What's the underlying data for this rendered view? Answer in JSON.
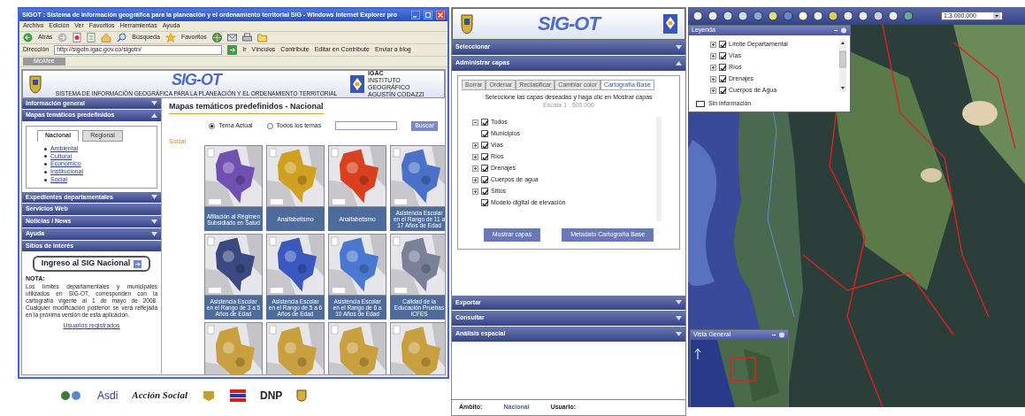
{
  "browser": {
    "title": "SIGOT : Sistema de información geográfica para la planeación y el ordenamiento territorial SIG - Windows Internet Explorer pro",
    "menu": [
      "Archivo",
      "Edición",
      "Ver",
      "Favoritos",
      "Herramientas",
      "Ayuda"
    ],
    "toolbar": [
      "Atrás",
      "Búsqueda",
      "Favoritos"
    ],
    "address_label": "Dirección",
    "address": "http://sigotn.igac.gov.co/sigotn/",
    "go": "Ir",
    "links_label": "Vínculos",
    "extras": [
      "Contribute",
      "Editar en Contribute",
      "Enviar a blog"
    ],
    "tab": "McAfee"
  },
  "site": {
    "logo": "SIG-OT",
    "subtitle": "SISTEMA DE INFORMACIÓN GEOGRÁFICA PARA LA PLANEACIÓN Y EL ORDENAMIENTO TERRITORIAL",
    "org": "IGAC",
    "org_sub": "INSTITUTO GEOGRÁFICO AGUSTÍN CODAZZI",
    "sidebar": [
      {
        "label": "Información general",
        "expanded": false,
        "arrow": true
      },
      {
        "label": "Mapas temáticos predefinidos",
        "expanded": true,
        "arrow": true,
        "tabs": [
          {
            "label": "Nacional",
            "selected": true
          },
          {
            "label": "Regional",
            "selected": false
          }
        ],
        "links": [
          "Ambiental",
          "Cultural",
          "Económico",
          "Institucional",
          "Social"
        ]
      },
      {
        "label": "Expedientes departamentales",
        "expanded": false,
        "arrow": true
      },
      {
        "label": "Servicios Web",
        "expanded": false,
        "arrow": false
      },
      {
        "label": "Noticias / News",
        "expanded": false,
        "arrow": true
      },
      {
        "label": "Ayuda",
        "expanded": false,
        "arrow": true
      },
      {
        "label": "Sitios de interés",
        "expanded": false,
        "arrow": false
      }
    ],
    "login_button": "Ingreso al SIG Nacional",
    "note_title": "NOTA:",
    "note": "Los límites departamentales y municipales utilizados en SIG-OT, corresponden con la cartografía vigente al 1 de mayo de 2008. Cualquier modificación posterior se verá reflejada en la próxima versión de esta aplicación.",
    "registered_link": "Usuarios registrados",
    "main_title": "Mapas temáticos predefinidos - Nacional",
    "radios": [
      {
        "label": "Tema Actual",
        "selected": true
      },
      {
        "label": "Todos los temas",
        "selected": false
      }
    ],
    "search_button": "Buscar",
    "theme": "Social",
    "maps": [
      {
        "caption": "Afiliación al Régimen Subsidiado en Salud",
        "color": "#7050b0"
      },
      {
        "caption": "Analfabetismo",
        "color": "#d0a020"
      },
      {
        "caption": "Analfabetismo",
        "color": "#d84020"
      },
      {
        "caption": "Asistencia Escolar en el Rango de 11 a 17 Años de Edad",
        "color": "#4a70c8"
      },
      {
        "caption": "Asistencia Escolar en el Rango de 3 a 5 Años de Edad",
        "color": "#3a4a80"
      },
      {
        "caption": "Asistencia Escolar en el Rango de 5 a 6 Años de Edad",
        "color": "#3a58c0"
      },
      {
        "caption": "Asistencia Escolar en el Rango de 6 a 10 Años de Edad",
        "color": "#4a78d0"
      },
      {
        "caption": "Calidad de la Educación Pruebas ICFES",
        "color": "#7a8098"
      }
    ],
    "partners": [
      "Asdi",
      "Acción Social",
      "DNP"
    ]
  },
  "layers": {
    "logo": "SIG-OT",
    "sections_top": [
      {
        "label": "Seleccionar",
        "expanded": false
      },
      {
        "label": "Administrar capas",
        "expanded": true
      }
    ],
    "tabs": [
      {
        "label": "Borrar",
        "selected": false
      },
      {
        "label": "Ordenar",
        "selected": false
      },
      {
        "label": "Reclasificar",
        "selected": false
      },
      {
        "label": "Cambiar color",
        "selected": false
      },
      {
        "label": "Cartografía Base",
        "selected": true
      }
    ],
    "instruction": "Seleccione las capas deseadas y haga clic en Mostrar capas",
    "scale": "Escala 1 : 500.000",
    "tree": [
      {
        "label": "Todos",
        "checked": true,
        "children": [
          {
            "label": "Municipios",
            "checked": true,
            "expandable": false
          },
          {
            "label": "Vías",
            "checked": true,
            "expandable": true
          },
          {
            "label": "Ríos",
            "checked": true,
            "expandable": true
          },
          {
            "label": "Drenajes",
            "checked": true,
            "expandable": true
          },
          {
            "label": "Cuerpos de agua",
            "checked": true,
            "expandable": true
          },
          {
            "label": "Sitios",
            "checked": true,
            "expandable": true
          },
          {
            "label": "Modelo digital de elevación",
            "checked": true,
            "expandable": false
          }
        ]
      }
    ],
    "buttons": [
      "Mostrar capas",
      "Metadato Cartografía Base"
    ],
    "sections_bottom": [
      {
        "label": "Exportar",
        "expanded": false
      },
      {
        "label": "Consultar",
        "expanded": false
      },
      {
        "label": "Análisis espacial",
        "expanded": false
      }
    ],
    "footer": [
      "Ámbito:",
      "Nacional",
      "Usuario:"
    ]
  },
  "map": {
    "scale": "1:3.000.000",
    "legend_title": "Leyenda",
    "legend": [
      {
        "label": "Límite Departamental",
        "checked": true
      },
      {
        "label": "Vías",
        "checked": true
      },
      {
        "label": "Ríos",
        "checked": true
      },
      {
        "label": "Drenajes",
        "checked": true
      },
      {
        "label": "Cuerpos de Agua",
        "checked": true
      }
    ],
    "no_info": "Sin información",
    "overview_title": "Vista General"
  }
}
